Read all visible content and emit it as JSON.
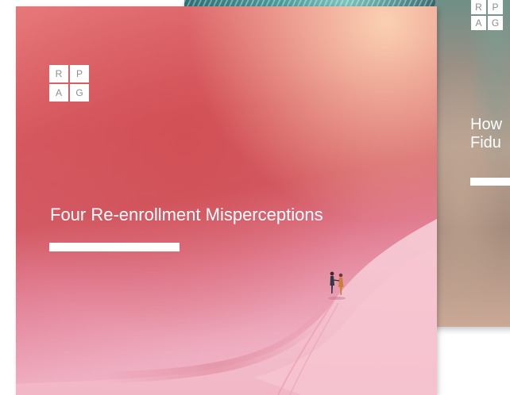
{
  "logo": {
    "letters": [
      "R",
      "P",
      "A",
      "G"
    ]
  },
  "main_slide": {
    "title": "Four Re-enrollment Misperceptions"
  },
  "right_slide": {
    "title_line1": "How",
    "title_line2": "Fidu"
  },
  "colors": {
    "main_red": "#d65860",
    "main_pink": "#efadc1",
    "sand_light": "#f4c7d3",
    "accent_white": "#ffffff",
    "logo_text": "#8d8d8d"
  },
  "icons": [
    "couple-walking-illustration"
  ]
}
